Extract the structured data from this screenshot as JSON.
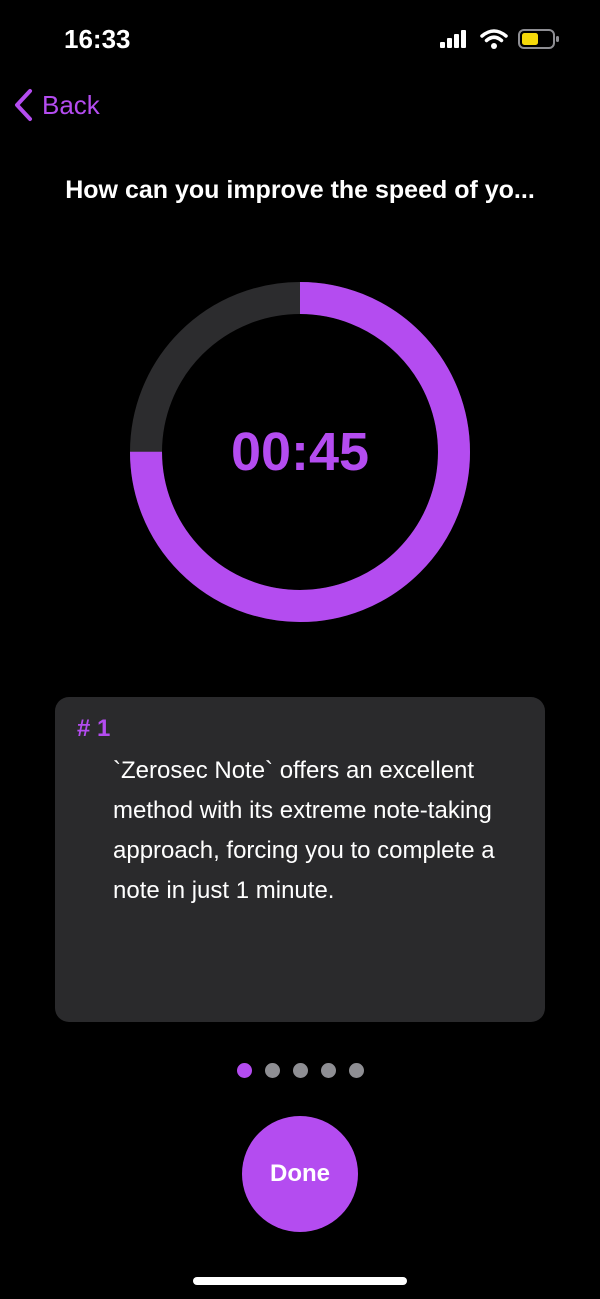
{
  "status_bar": {
    "time": "16:33",
    "icons": [
      "signal-icon",
      "wifi-icon",
      "battery-icon"
    ],
    "battery_color": "#f5d90a"
  },
  "nav": {
    "back_label": "Back"
  },
  "title": "How can you improve the speed of yo...",
  "timer": {
    "display": "00:45",
    "progress_fraction": 0.75,
    "progress_color": "#b44cf0",
    "track_color": "#2c2c2e"
  },
  "tip": {
    "number_label": "# 1",
    "text": "`Zerosec Note` offers an excellent method with its extreme note-taking approach, forcing you to complete a note in just 1 minute."
  },
  "pagination": {
    "total": 5,
    "current": 1,
    "active_color": "#b44cf0",
    "inactive_color": "#8e8e93"
  },
  "done_button_label": "Done"
}
